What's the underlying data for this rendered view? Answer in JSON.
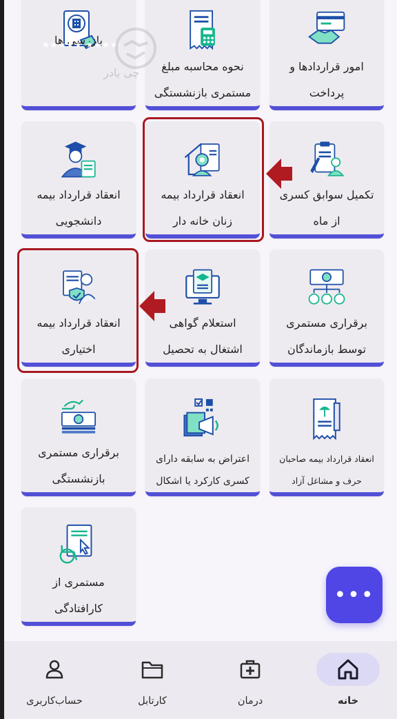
{
  "tiles": [
    {
      "id": "contracts",
      "lines": [
        "امور قراردادها و",
        "پرداخت"
      ],
      "icon": "contract-payment-icon"
    },
    {
      "id": "pension-calc",
      "lines": [
        "نحوه محاسبه مبلغ",
        "مستمری بازنشستگی"
      ],
      "icon": "pension-calculator-icon"
    },
    {
      "id": "inspections",
      "lines": [
        "",
        "بازرسی ها"
      ],
      "icon": "inspection-icon"
    },
    {
      "id": "monthly-records",
      "lines": [
        "تکمیل سوابق کسری",
        "از ماه"
      ],
      "icon": "records-clipboard-icon"
    },
    {
      "id": "housewives-insurance",
      "lines": [
        "انعقاد قرارداد بیمه",
        "زنان خانه دار"
      ],
      "icon": "housewife-icon"
    },
    {
      "id": "student-insurance",
      "lines": [
        "انعقاد قرارداد بیمه",
        "دانشجویی"
      ],
      "icon": "student-icon"
    },
    {
      "id": "survivors-pension",
      "lines": [
        "برقراری مستمری",
        "توسط بازماندگان"
      ],
      "icon": "survivors-icon"
    },
    {
      "id": "education-certificate",
      "lines": [
        "استعلام گواهی",
        "اشتغال به تحصیل"
      ],
      "icon": "education-monitor-icon"
    },
    {
      "id": "optional-insurance",
      "lines": [
        "انعقاد قرارداد بیمه",
        "اختیاری"
      ],
      "icon": "optional-insurance-icon"
    },
    {
      "id": "self-employed-insurance",
      "lines": [
        "انعقاد قرارداد بیمه صاحبان",
        "حرف و مشاغل آزاد"
      ],
      "icon": "self-employed-icon"
    },
    {
      "id": "objection",
      "lines": [
        "اعتراض به سابقه دارای",
        "کسری کارکرد یا اشکال"
      ],
      "icon": "objection-megaphone-icon"
    },
    {
      "id": "retirement-pension",
      "lines": [
        "برقراری مستمری",
        "بازنشستگی"
      ],
      "icon": "retirement-money-icon"
    },
    {
      "id": "disability-pension",
      "lines": [
        "مستمری از",
        "کارافتادگی"
      ],
      "icon": "disability-icon"
    }
  ],
  "watermark": {
    "stars": "★★★★★·★★★★·",
    "brand": "چی یادر"
  },
  "fab": {
    "label": "•••"
  },
  "nav": [
    {
      "id": "home",
      "label": "خانه",
      "active": true,
      "icon": "home-icon"
    },
    {
      "id": "treatment",
      "label": "درمان",
      "active": false,
      "icon": "medical-kit-icon"
    },
    {
      "id": "cartable",
      "label": "کارتابل",
      "active": false,
      "icon": "folder-icon"
    },
    {
      "id": "account",
      "label": "حساب‌کاربری",
      "active": false,
      "icon": "user-icon"
    }
  ],
  "colors": {
    "accent": "#5250d6",
    "highlight": "#a81820",
    "icon_blue": "#1e4fa8",
    "icon_green": "#17b58f"
  }
}
